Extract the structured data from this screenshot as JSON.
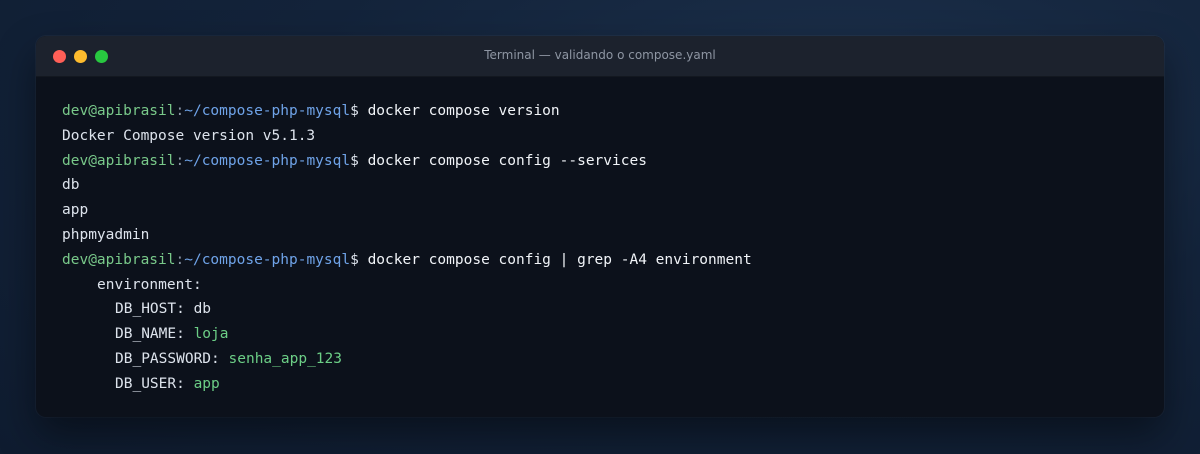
{
  "window": {
    "title": "Terminal — validando o compose.yaml",
    "controls": [
      {
        "name": "close",
        "color": "#ff5f57"
      },
      {
        "name": "minimize",
        "color": "#febc2e"
      },
      {
        "name": "maximize",
        "color": "#28c840"
      }
    ]
  },
  "prompt": {
    "user_host": "dev@apibrasil",
    "separator": ":",
    "path": "~/compose-php-mysql",
    "symbol": "$"
  },
  "terminal": {
    "commands": [
      "docker compose version",
      "docker compose config --services",
      "docker compose config | grep -A4 environment"
    ],
    "output_version": "Docker Compose version v5.1.3",
    "services": [
      "db",
      "app",
      "phpmyadmin"
    ],
    "env_header": "environment:",
    "env": [
      {
        "key": "DB_HOST:",
        "value": "db"
      },
      {
        "key": "DB_NAME:",
        "value": "loja"
      },
      {
        "key": "DB_PASSWORD:",
        "value": "senha_app_123"
      },
      {
        "key": "DB_USER:",
        "value": "app"
      }
    ]
  },
  "colors": {
    "prompt_user": "#79c98a",
    "prompt_path": "#6fa3e8",
    "string_value": "#6cce86",
    "terminal_bg": "#0c111b",
    "titlebar_bg": "#1c222d"
  }
}
